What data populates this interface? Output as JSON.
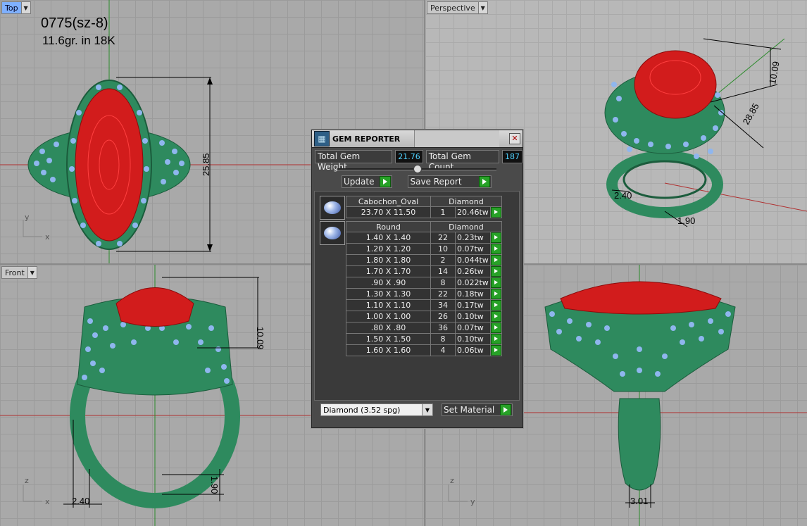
{
  "viewports": {
    "top": {
      "label": "Top"
    },
    "perspective": {
      "label": "Perspective"
    },
    "front": {
      "label": "Front"
    }
  },
  "annotation": {
    "line1": "0775(sz-8)",
    "line2": "11.6gr.  in 18K"
  },
  "dimensions": {
    "top_height": "25.85",
    "front_height": "10.09",
    "front_band": "2.40",
    "front_base": "1.90",
    "right_width": "3.01",
    "persp_a": "10.09",
    "persp_b": "28.85",
    "persp_c": "2.40",
    "persp_d": "1.90"
  },
  "axes": {
    "x": "x",
    "y": "y",
    "z": "z"
  },
  "panel": {
    "title": "GEM REPORTER",
    "total_weight_label": "Total Gem Weight",
    "total_weight_value": "21.76",
    "total_count_label": "Total Gem Count",
    "total_count_value": "187",
    "update_label": "Update",
    "save_report_label": "Save Report",
    "set_material_label": "Set Material",
    "material_select": "Diamond    (3.52 spg)"
  },
  "groups": [
    {
      "shape": "Cabochon_Oval",
      "material": "Diamond",
      "rows": [
        {
          "size": "23.70 X 11.50",
          "count": "1",
          "weight": "20.46tw"
        }
      ]
    },
    {
      "shape": "Round",
      "material": "Diamond",
      "rows": [
        {
          "size": "1.40 X 1.40",
          "count": "22",
          "weight": "0.23tw"
        },
        {
          "size": "1.20 X 1.20",
          "count": "10",
          "weight": "0.07tw"
        },
        {
          "size": "1.80 X 1.80",
          "count": "2",
          "weight": "0.044tw"
        },
        {
          "size": "1.70 X 1.70",
          "count": "14",
          "weight": "0.26tw"
        },
        {
          "size": ".90 X .90",
          "count": "8",
          "weight": "0.022tw"
        },
        {
          "size": "1.30 X 1.30",
          "count": "22",
          "weight": "0.18tw"
        },
        {
          "size": "1.10 X 1.10",
          "count": "34",
          "weight": "0.17tw"
        },
        {
          "size": "1.00 X 1.00",
          "count": "26",
          "weight": "0.10tw"
        },
        {
          "size": ".80 X .80",
          "count": "36",
          "weight": "0.07tw"
        },
        {
          "size": "1.50 X 1.50",
          "count": "8",
          "weight": "0.10tw"
        },
        {
          "size": "1.60 X 1.60",
          "count": "4",
          "weight": "0.06tw"
        }
      ]
    }
  ],
  "colors": {
    "metal": "#2e8a5e",
    "stone": "#d21c1c",
    "diamond": "#8fb6ee",
    "active_viewport": "#7fb0ff"
  }
}
